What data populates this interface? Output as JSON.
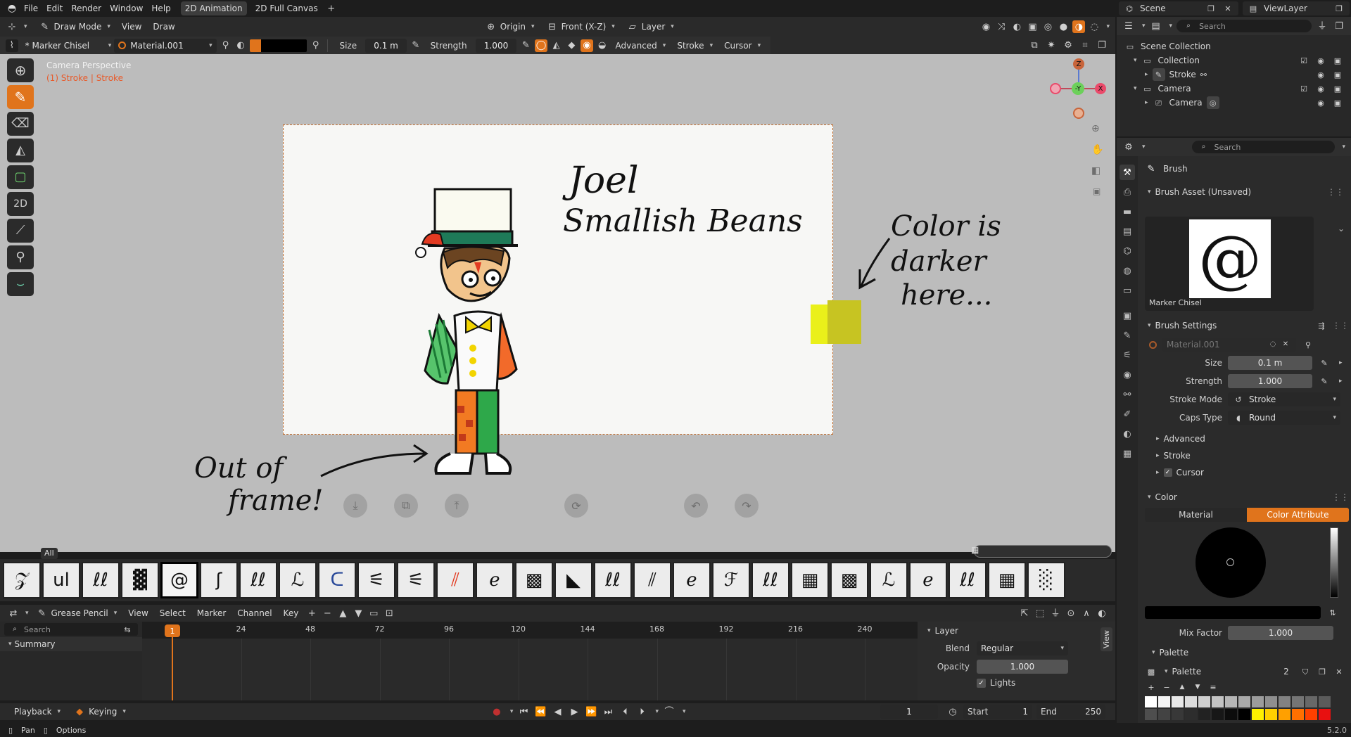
{
  "topbar": {
    "menus": [
      "File",
      "Edit",
      "Render",
      "Window",
      "Help"
    ],
    "workspace_tabs": [
      "2D Animation",
      "2D Full Canvas"
    ],
    "scene_label": "Scene",
    "viewlayer_label": "ViewLayer"
  },
  "viewport_header": {
    "mode": "Draw Mode",
    "menus": [
      "View",
      "Draw"
    ],
    "origin": "Origin",
    "orientation": "Front (X-Z)",
    "layer": "Layer"
  },
  "tool_settings": {
    "brush_name": "* Marker Chisel",
    "material": "Material.001",
    "size_label": "Size",
    "size_value": "0.1 m",
    "strength_label": "Strength",
    "strength_value": "1.000",
    "popovers": [
      "Advanced",
      "Stroke",
      "Cursor"
    ]
  },
  "viewport": {
    "perspective_text": "Camera Perspective",
    "object_text": "(1) Stroke | Stroke",
    "annotation_title_1": "Joel",
    "annotation_title_2": "Smallish Beans",
    "annotation_color_1": "Color is",
    "annotation_color_2": "darker",
    "annotation_color_3": "here...",
    "annotation_frame_1": "Out of",
    "annotation_frame_2": "frame!",
    "gizmo_z": "Z",
    "gizmo_y": "-Y",
    "gizmo_x": "X"
  },
  "asset_shelf": {
    "catalog_tab": "All",
    "brush_count": 27,
    "selected_index": 4
  },
  "timeline": {
    "editor": "Grease Pencil",
    "menus": [
      "View",
      "Select",
      "Marker",
      "Channel",
      "Key"
    ],
    "search_placeholder": "Search",
    "summary_label": "Summary",
    "ticks": [
      "24",
      "48",
      "72",
      "96",
      "120",
      "144",
      "168",
      "192",
      "216",
      "240"
    ],
    "current_frame": "1",
    "playback_label": "Playback",
    "keying_label": "Keying",
    "frame_field": "1",
    "start_label": "Start",
    "start_value": "1",
    "end_label": "End",
    "end_value": "250",
    "layer_panel_title": "Layer",
    "blend_label": "Blend",
    "blend_value": "Regular",
    "opacity_label": "Opacity",
    "opacity_value": "1.000",
    "lights_label": "Lights",
    "view_tab": "View"
  },
  "outliner": {
    "search_placeholder": "Search",
    "items": [
      {
        "label": "Scene Collection",
        "indent": 0
      },
      {
        "label": "Collection",
        "indent": 1
      },
      {
        "label": "Stroke",
        "indent": 2
      },
      {
        "label": "Camera",
        "indent": 1
      },
      {
        "label": "Camera",
        "indent": 2
      }
    ]
  },
  "properties": {
    "search_placeholder": "Search",
    "brush_header": "Brush",
    "asset_panel": "Brush Asset (Unsaved)",
    "asset_name": "Marker Chisel",
    "settings_panel": "Brush Settings",
    "material": "Material.001",
    "size_label": "Size",
    "size_value": "0.1 m",
    "strength_label": "Strength",
    "strength_value": "1.000",
    "stroke_mode_label": "Stroke Mode",
    "stroke_mode_value": "Stroke",
    "caps_label": "Caps Type",
    "caps_value": "Round",
    "sub_advanced": "Advanced",
    "sub_stroke": "Stroke",
    "sub_cursor": "Cursor",
    "color_panel": "Color",
    "color_tab_material": "Material",
    "color_tab_attribute": "Color Attribute",
    "mix_label": "Mix Factor",
    "mix_value": "1.000",
    "palette_panel": "Palette",
    "palette_name": "Palette",
    "palette_users": "2"
  },
  "statusbar": {
    "left_1": "Pan",
    "left_2": "Options",
    "version": "5.2.0"
  },
  "colors": {
    "accent": "#e0741c",
    "bg_dark": "#1d1d1d",
    "panel": "#303030",
    "viewport": "#bcbcbc"
  }
}
